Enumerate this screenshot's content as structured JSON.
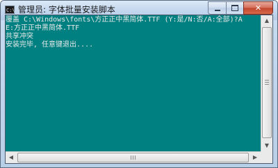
{
  "window": {
    "title": "管理员:  字体批量安装脚本",
    "icon_label": "C:\\"
  },
  "caption_buttons": {
    "minimize_icon": "minimize-icon",
    "maximize_icon": "maximize-icon",
    "close_glyph": "✕"
  },
  "console": {
    "lines": [
      "覆盖 C:\\Windows\\fonts\\方正正中黑简体.TTF (Y:是/N:否/A:全部)?A",
      "E:方正正中黑简体.TTF",
      "共享冲突",
      "安装完毕, 任意键退出...."
    ]
  },
  "scrollbars": {
    "up_arrow": "▲",
    "down_arrow": "▼",
    "left_arrow": "◀",
    "right_arrow": "▶"
  },
  "colors": {
    "console_background": "#008080",
    "console_text": "#e8e8e8"
  }
}
